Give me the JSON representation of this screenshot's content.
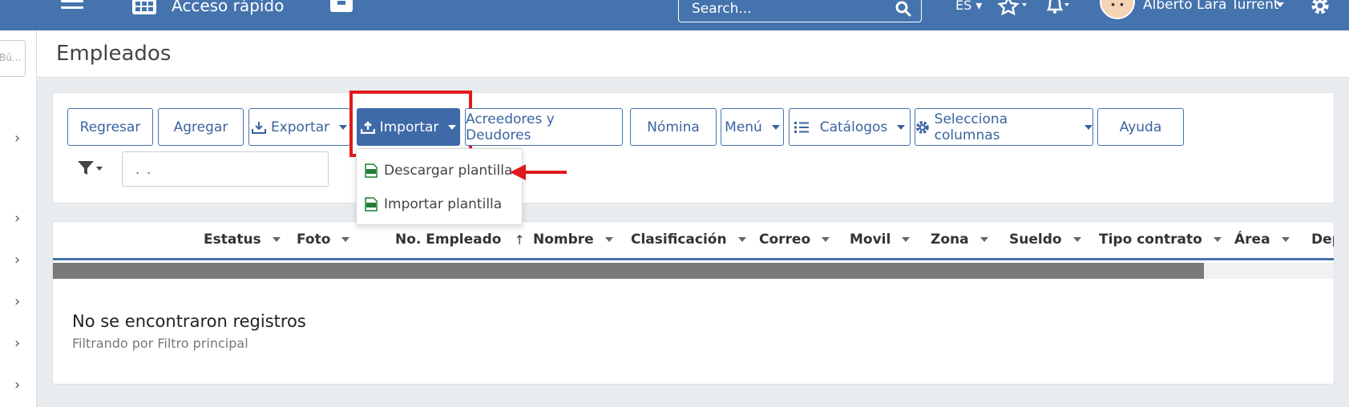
{
  "topbar": {
    "quick_access": "Acceso rápido",
    "search_placeholder": "Search...",
    "language": "ES",
    "user_name": "Alberto Lara Turrent"
  },
  "sidebar": {
    "search_placeholder": "Bú..."
  },
  "page": {
    "title": "Empleados"
  },
  "toolbar": {
    "back": "Regresar",
    "add": "Agregar",
    "export": "Exportar",
    "import": "Importar",
    "creditors": "Acreedores y Deudores",
    "payroll": "Nómina",
    "menu": "Menú",
    "catalogs": "Catálogos",
    "columns": "Selecciona columnas",
    "help": "Ayuda"
  },
  "filter": {
    "value": ". ."
  },
  "import_menu": {
    "items": [
      {
        "label": "Descargar plantilla",
        "icon": "xls-file-icon"
      },
      {
        "label": "Importar plantilla",
        "icon": "xls-file-icon"
      }
    ]
  },
  "table": {
    "columns": [
      "Estatus",
      "Foto",
      "No. Empleado",
      "Nombre",
      "Clasificación",
      "Correo",
      "Movil",
      "Zona",
      "Sueldo",
      "Tipo contrato",
      "Área",
      "Dep"
    ],
    "sorted_column": "No. Empleado",
    "empty_title": "No se encontraron registros",
    "empty_subtitle": "Filtrando por Filtro principal"
  },
  "colors": {
    "topbar": "#4473ad",
    "primary_button": "#3e6aa8",
    "highlight": "#e0191e",
    "xls_icon": "#1e7e34"
  }
}
